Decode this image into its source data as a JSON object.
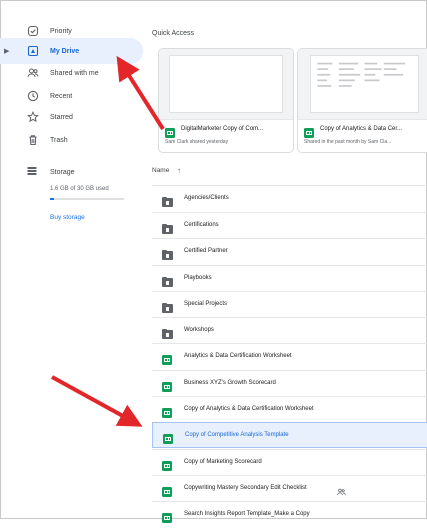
{
  "sidebar": {
    "items": [
      {
        "label": "Priority",
        "icon": "check-circle-icon"
      },
      {
        "label": "My Drive",
        "icon": "drive-icon"
      },
      {
        "label": "Shared with me",
        "icon": "people-icon"
      },
      {
        "label": "Recent",
        "icon": "clock-icon"
      },
      {
        "label": "Starred",
        "icon": "star-icon"
      },
      {
        "label": "Trash",
        "icon": "trash-icon"
      }
    ],
    "storage": {
      "label": "Storage",
      "used": "1.6 GB of 30 GB used",
      "used_fraction": 0.053,
      "buy": "Buy storage"
    }
  },
  "quick_access": {
    "title": "Quick Access",
    "cards": [
      {
        "title": "DigitalMarketer Copy of Com...",
        "subtitle": "Sam Clark shared yesterday"
      },
      {
        "title": "Copy of Analytics & Data Cer...",
        "subtitle": "Shared in the past month by Sam Cla..."
      }
    ]
  },
  "files": {
    "name_header": "Name",
    "sort_icon": "arrow-up-icon",
    "rows": [
      {
        "name": "Agencies/Clients",
        "type": "shared-folder"
      },
      {
        "name": "Certifications",
        "type": "shared-folder"
      },
      {
        "name": "Certified Partner",
        "type": "shared-folder"
      },
      {
        "name": "Playbooks",
        "type": "shared-folder"
      },
      {
        "name": "Special Projects",
        "type": "shared-folder"
      },
      {
        "name": "Workshops",
        "type": "shared-folder"
      },
      {
        "name": "Analytics & Data Certification Worksheet",
        "type": "sheet"
      },
      {
        "name": "Business XYZ's Growth Scorecard",
        "type": "sheet"
      },
      {
        "name": "Copy of Analytics & Data Certification Worksheet",
        "type": "sheet"
      },
      {
        "name": "Copy of Competitive Analysis Template",
        "type": "sheet",
        "selected": true
      },
      {
        "name": "Copy of Marketing Scorecard",
        "type": "sheet"
      },
      {
        "name": "Copywriting Mastery Secondary Edit Checklist",
        "type": "sheet",
        "shared": true
      },
      {
        "name": "Search Insights Report Template_Make a Copy",
        "type": "sheet"
      }
    ]
  },
  "colors": {
    "accent": "#1a73e8",
    "selected_bg": "#e8f0fe",
    "sheets_green": "#0f9d58",
    "annotation_arrow": "#e3262a"
  }
}
